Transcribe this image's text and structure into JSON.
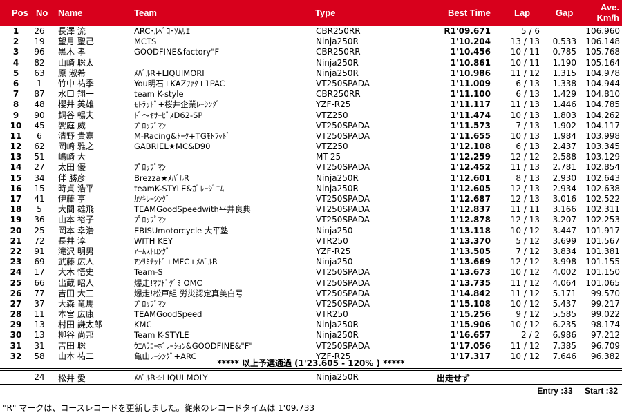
{
  "header": {
    "pos": "Pos",
    "no": "No",
    "name": "Name",
    "team": "Team",
    "type": "Type",
    "best": "Best Time",
    "lap": "Lap",
    "gap": "Gap",
    "ave1": "Ave.",
    "ave2": "Km/h"
  },
  "colors": {
    "header_bg": "#d8001c",
    "header_text": "#ffffff"
  },
  "results": [
    {
      "pos": "1",
      "no": "26",
      "name": "長澤 流",
      "team": "ARC･ﾙﾍﾞﾛ･ｿﾑﾘｴ",
      "type": "CBR250RR",
      "best": "R1'09.671",
      "lap": "5 / 6",
      "gap": "",
      "ave": "106.960"
    },
    {
      "pos": "2",
      "no": "19",
      "name": "望月 聖己",
      "team": "MCTS",
      "type": "Ninja250R",
      "best": "1'10.204",
      "lap": "13 / 13",
      "gap": "0.533",
      "ave": "106.148"
    },
    {
      "pos": "3",
      "no": "96",
      "name": "黒木 孝",
      "team": "GOODFINE&factory\"F",
      "type": "CBR250RR",
      "best": "1'10.456",
      "lap": "10 / 11",
      "gap": "0.785",
      "ave": "105.768"
    },
    {
      "pos": "4",
      "no": "82",
      "name": "山崎 聡太",
      "team": "",
      "type": "Ninja250R",
      "best": "1'10.861",
      "lap": "10 / 11",
      "gap": "1.190",
      "ave": "105.164"
    },
    {
      "pos": "5",
      "no": "63",
      "name": "原 淑希",
      "team": "ﾒﾊﾞﾙR+LIQUIMORI",
      "type": "Ninja250R",
      "best": "1'10.986",
      "lap": "11 / 12",
      "gap": "1.315",
      "ave": "104.978"
    },
    {
      "pos": "6",
      "no": "1",
      "name": "竹中 祐季",
      "team": "You明石+KAZﾌｧｸ+1PAC",
      "type": "VT250SPADA",
      "best": "1'11.009",
      "lap": "6 / 13",
      "gap": "1.338",
      "ave": "104.944"
    },
    {
      "pos": "7",
      "no": "87",
      "name": "水口 翔一",
      "team": "team K-style",
      "type": "CBR250RR",
      "best": "1'11.100",
      "lap": "6 / 13",
      "gap": "1.429",
      "ave": "104.810"
    },
    {
      "pos": "8",
      "no": "48",
      "name": "櫻井 英雄",
      "team": "ﾓﾄﾗｯﾄﾞ+桜井企業ﾚｰｼﾝｸﾞ",
      "type": "YZF-R25",
      "best": "1'11.117",
      "lap": "11 / 13",
      "gap": "1.446",
      "ave": "104.785"
    },
    {
      "pos": "9",
      "no": "90",
      "name": "銅谷 暢夫",
      "team": "ﾄﾞ～ﾔｻｰﾋﾞｽD62-SP",
      "type": "VTZ250",
      "best": "1'11.474",
      "lap": "10 / 13",
      "gap": "1.803",
      "ave": "104.262"
    },
    {
      "pos": "10",
      "no": "45",
      "name": "饗庭 威",
      "team": "ﾌﾟﾛｯﾌﾟﾏﾝ",
      "type": "VT250SPADA",
      "best": "1'11.573",
      "lap": "7 / 13",
      "gap": "1.902",
      "ave": "104.117"
    },
    {
      "pos": "11",
      "no": "6",
      "name": "清野 貴嘉",
      "team": "M-Racing&ﾄｰｸ+TGﾓﾄﾗｯﾄﾞ",
      "type": "VT250SPADA",
      "best": "1'11.655",
      "lap": "10 / 13",
      "gap": "1.984",
      "ave": "103.998"
    },
    {
      "pos": "12",
      "no": "62",
      "name": "岡崎 雅之",
      "team": "GABRIEL★MC&D90",
      "type": "VTZ250",
      "best": "1'12.108",
      "lap": "6 / 13",
      "gap": "2.437",
      "ave": "103.345"
    },
    {
      "pos": "13",
      "no": "51",
      "name": "嶋崎 大",
      "team": "",
      "type": "MT-25",
      "best": "1'12.259",
      "lap": "12 / 12",
      "gap": "2.588",
      "ave": "103.129"
    },
    {
      "pos": "14",
      "no": "27",
      "name": "太田 優",
      "team": "ﾌﾟﾛｯﾌﾟﾏﾝ",
      "type": "VT250SPADA",
      "best": "1'12.452",
      "lap": "11 / 13",
      "gap": "2.781",
      "ave": "102.854"
    },
    {
      "pos": "15",
      "no": "34",
      "name": "伴 勝彦",
      "team": "Brezza★ﾒﾊﾞﾙR",
      "type": "Ninja250R",
      "best": "1'12.601",
      "lap": "8 / 13",
      "gap": "2.930",
      "ave": "102.643"
    },
    {
      "pos": "16",
      "no": "15",
      "name": "時貞 浩平",
      "team": "teamK-STYLE&ｶﾞﾚｰｼﾞｴﾑ",
      "type": "Ninja250R",
      "best": "1'12.605",
      "lap": "12 / 13",
      "gap": "2.934",
      "ave": "102.638"
    },
    {
      "pos": "17",
      "no": "41",
      "name": "伊藤 亨",
      "team": "ｶﾂｷﾚｰｼﾝｸﾞ",
      "type": "VT250SPADA",
      "best": "1'12.687",
      "lap": "12 / 13",
      "gap": "3.016",
      "ave": "102.522"
    },
    {
      "pos": "18",
      "no": "5",
      "name": "大間 雄飛",
      "team": "TEAMGoodSpeedwith平井良典",
      "type": "VT250SPADA",
      "best": "1'12.837",
      "lap": "11 / 11",
      "gap": "3.166",
      "ave": "102.311"
    },
    {
      "pos": "19",
      "no": "36",
      "name": "山本 裕子",
      "team": "ﾌﾟﾛｯﾌﾟﾏﾝ",
      "type": "VT250SPADA",
      "best": "1'12.878",
      "lap": "12 / 13",
      "gap": "3.207",
      "ave": "102.253"
    },
    {
      "pos": "20",
      "no": "25",
      "name": "岡本 幸浩",
      "team": "EBISUmotorcycle 大平塾",
      "type": "Ninja250",
      "best": "1'13.118",
      "lap": "10 / 12",
      "gap": "3.447",
      "ave": "101.917"
    },
    {
      "pos": "21",
      "no": "72",
      "name": "長井 淳",
      "team": "WITH KEY",
      "type": "VTR250",
      "best": "1'13.370",
      "lap": "5 / 12",
      "gap": "3.699",
      "ave": "101.567"
    },
    {
      "pos": "22",
      "no": "91",
      "name": "滝沢 明男",
      "team": "ｱｰﾑｽﾄﾛﾝｸﾞ",
      "type": "YZF-R25",
      "best": "1'13.505",
      "lap": "7 / 12",
      "gap": "3.834",
      "ave": "101.381"
    },
    {
      "pos": "23",
      "no": "69",
      "name": "武藤 広人",
      "team": "ｱﾝﾘﾐﾃｯﾄﾞ+MFC+ﾒﾊﾞﾙR",
      "type": "Ninja250",
      "best": "1'13.669",
      "lap": "12 / 12",
      "gap": "3.998",
      "ave": "101.155"
    },
    {
      "pos": "24",
      "no": "17",
      "name": "大木 悟史",
      "team": "Team-S",
      "type": "VT250SPADA",
      "best": "1'13.673",
      "lap": "10 / 12",
      "gap": "4.002",
      "ave": "101.150"
    },
    {
      "pos": "25",
      "no": "66",
      "name": "出蔵 昭人",
      "team": "爆走!ﾏﾂﾄﾞｸﾞﾐ OMC",
      "type": "VT250SPADA",
      "best": "1'13.735",
      "lap": "11 / 12",
      "gap": "4.064",
      "ave": "101.065"
    },
    {
      "pos": "26",
      "no": "77",
      "name": "吉田 大三",
      "team": "爆走!松戸組 労災認定真美白号",
      "type": "VT250SPADA",
      "best": "1'14.842",
      "lap": "11 / 12",
      "gap": "5.171",
      "ave": "99.570"
    },
    {
      "pos": "27",
      "no": "37",
      "name": "大森 竜馬",
      "team": "ﾌﾟﾛｯﾌﾟﾏﾝ",
      "type": "VT250SPADA",
      "best": "1'15.108",
      "lap": "10 / 12",
      "gap": "5.437",
      "ave": "99.217"
    },
    {
      "pos": "28",
      "no": "11",
      "name": "本宮 広康",
      "team": "TEAMGoodSpeed",
      "type": "VTR250",
      "best": "1'15.256",
      "lap": "9 / 12",
      "gap": "5.585",
      "ave": "99.022"
    },
    {
      "pos": "29",
      "no": "13",
      "name": "村田 謙太郎",
      "team": "KMC",
      "type": "Ninja250R",
      "best": "1'15.906",
      "lap": "10 / 12",
      "gap": "6.235",
      "ave": "98.174"
    },
    {
      "pos": "30",
      "no": "13",
      "name": "柳谷 尚邦",
      "team": "Team K-STYLE",
      "type": "Ninja250R",
      "best": "1'16.657",
      "lap": "2 / 2",
      "gap": "6.986",
      "ave": "97.212"
    },
    {
      "pos": "31",
      "no": "31",
      "name": "吉田 聡",
      "team": "ｳｴﾊﾗｺｰﾎﾟﾚｰｼｮﾝ&GOODFINE&\"F\"",
      "type": "VT250SPADA",
      "best": "1'17.056",
      "lap": "11 / 12",
      "gap": "7.385",
      "ave": "96.709"
    },
    {
      "pos": "32",
      "no": "58",
      "name": "山本 祐二",
      "team": "亀山ﾚｰｼﾝｸﾞ+ARC",
      "type": "YZF-R25",
      "best": "1'17.317",
      "lap": "10 / 12",
      "gap": "7.646",
      "ave": "96.382"
    }
  ],
  "qualify_note": "***** 以上予選通過 (1'23.605 - 120% ) *****",
  "dns_row": {
    "no": "24",
    "name": "松井 愛",
    "team": "ﾒﾊﾞﾙR☆LIQUI MOLY",
    "type": "Ninja250R",
    "status": "出走せず"
  },
  "summary": {
    "entry": "Entry :33",
    "start": "Start :32"
  },
  "footer": "\"R\" マークは、コースレコードを更新しました。従来のレコードタイムは 1'09.733"
}
